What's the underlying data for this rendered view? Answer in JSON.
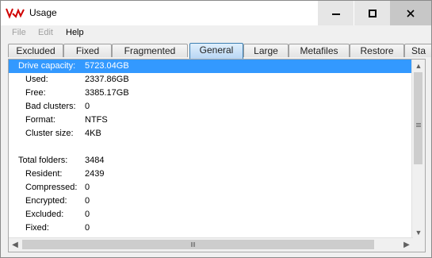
{
  "window": {
    "title": "Usage"
  },
  "titlebar": {
    "minimize_icon": "minimize-icon",
    "maximize_icon": "maximize-icon",
    "close_icon": "close-icon"
  },
  "menu": [
    {
      "label": "File",
      "enabled": false
    },
    {
      "label": "Edit",
      "enabled": false
    },
    {
      "label": "Help",
      "enabled": true
    }
  ],
  "tabs": [
    {
      "label": "Excluded"
    },
    {
      "label": "Fixed"
    },
    {
      "label": "Fragmented"
    },
    {
      "label": "General",
      "active": true
    },
    {
      "label": "Large"
    },
    {
      "label": "Metafiles"
    },
    {
      "label": "Restore"
    },
    {
      "label": "Sta"
    }
  ],
  "rows": [
    {
      "label": "Drive capacity:",
      "value": "5723.04GB",
      "selected": true
    },
    {
      "label": "Used:",
      "value": "2337.86GB"
    },
    {
      "label": "Free:",
      "value": "3385.17GB"
    },
    {
      "label": "Bad clusters:",
      "value": "0"
    },
    {
      "label": "Format:",
      "value": "NTFS"
    },
    {
      "label": "Cluster size:",
      "value": "4KB"
    },
    {
      "label": "",
      "value": ""
    },
    {
      "label": "Total folders:",
      "value": "3484"
    },
    {
      "label": "Resident:",
      "value": "2439"
    },
    {
      "label": "Compressed:",
      "value": "0"
    },
    {
      "label": "Encrypted:",
      "value": "0"
    },
    {
      "label": "Excluded:",
      "value": "0"
    },
    {
      "label": "Fixed:",
      "value": "0"
    }
  ],
  "colors": {
    "selection": "#3399ff",
    "active_tab_border": "#3c7fb1",
    "close_bg": "#c7c7c7"
  }
}
